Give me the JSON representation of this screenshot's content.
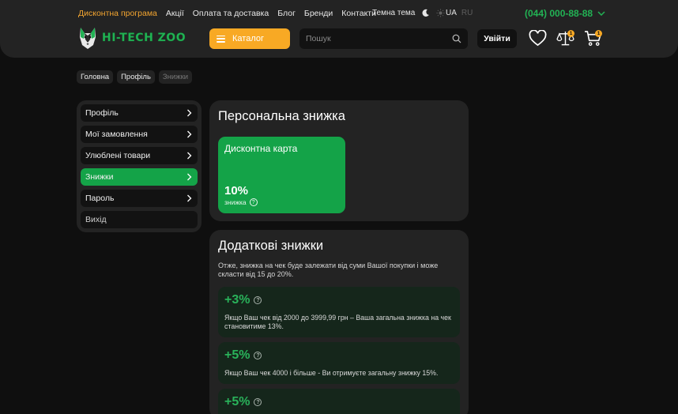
{
  "header": {
    "nav": [
      "Дисконтна програма",
      "Акції",
      "Оплата та доставка",
      "Блог",
      "Бренди",
      "Контакти"
    ],
    "theme_label": "Темна тема",
    "lang_active": "UA",
    "lang_inactive": "RU",
    "phone": "(044) 000-88-88",
    "logo_text": "HI-TECH ZOO",
    "catalog_label": "Каталог",
    "search_placeholder": "Пошук",
    "login_label": "Увійти",
    "compare_count": "1",
    "cart_count": "1",
    "accent": "#f8a924",
    "brand": "#22b254"
  },
  "breadcrumb": [
    "Головна",
    "Профіль",
    "Знижки"
  ],
  "sidebar": {
    "items": [
      {
        "label": "Профіль"
      },
      {
        "label": "Мої замовлення"
      },
      {
        "label": "Улюблені товари"
      },
      {
        "label": "Знижки"
      },
      {
        "label": "Пароль"
      },
      {
        "label": "Вихід"
      }
    ],
    "active": "Знижки"
  },
  "personal": {
    "title": "Персональна знижка",
    "card_title": "Дисконтна карта",
    "value": "10%",
    "sub": "знижка"
  },
  "extra": {
    "title": "Додаткові знижки",
    "intro": "Отже, знижка на чек буде залежати від суми Вашої покупки і може скласти від 15 до 20%.",
    "items": [
      {
        "pct": "+3%",
        "desc": "Якщо Ваш чек від 2000 до 3999,99 грн – Ваша загальна знижка на чек становитиме 13%."
      },
      {
        "pct": "+5%",
        "desc": "Якщо Ваш чек 4000 і більше -  Ви отримуєте загальну знижку 15%."
      },
      {
        "pct": "+5%",
        "desc": ""
      }
    ]
  },
  "icons": [
    "moon-icon",
    "sun-icon",
    "chevron-down-icon",
    "search-icon",
    "heart-icon",
    "scales-icon",
    "cart-icon",
    "question-icon",
    "chevron-right-icon"
  ]
}
